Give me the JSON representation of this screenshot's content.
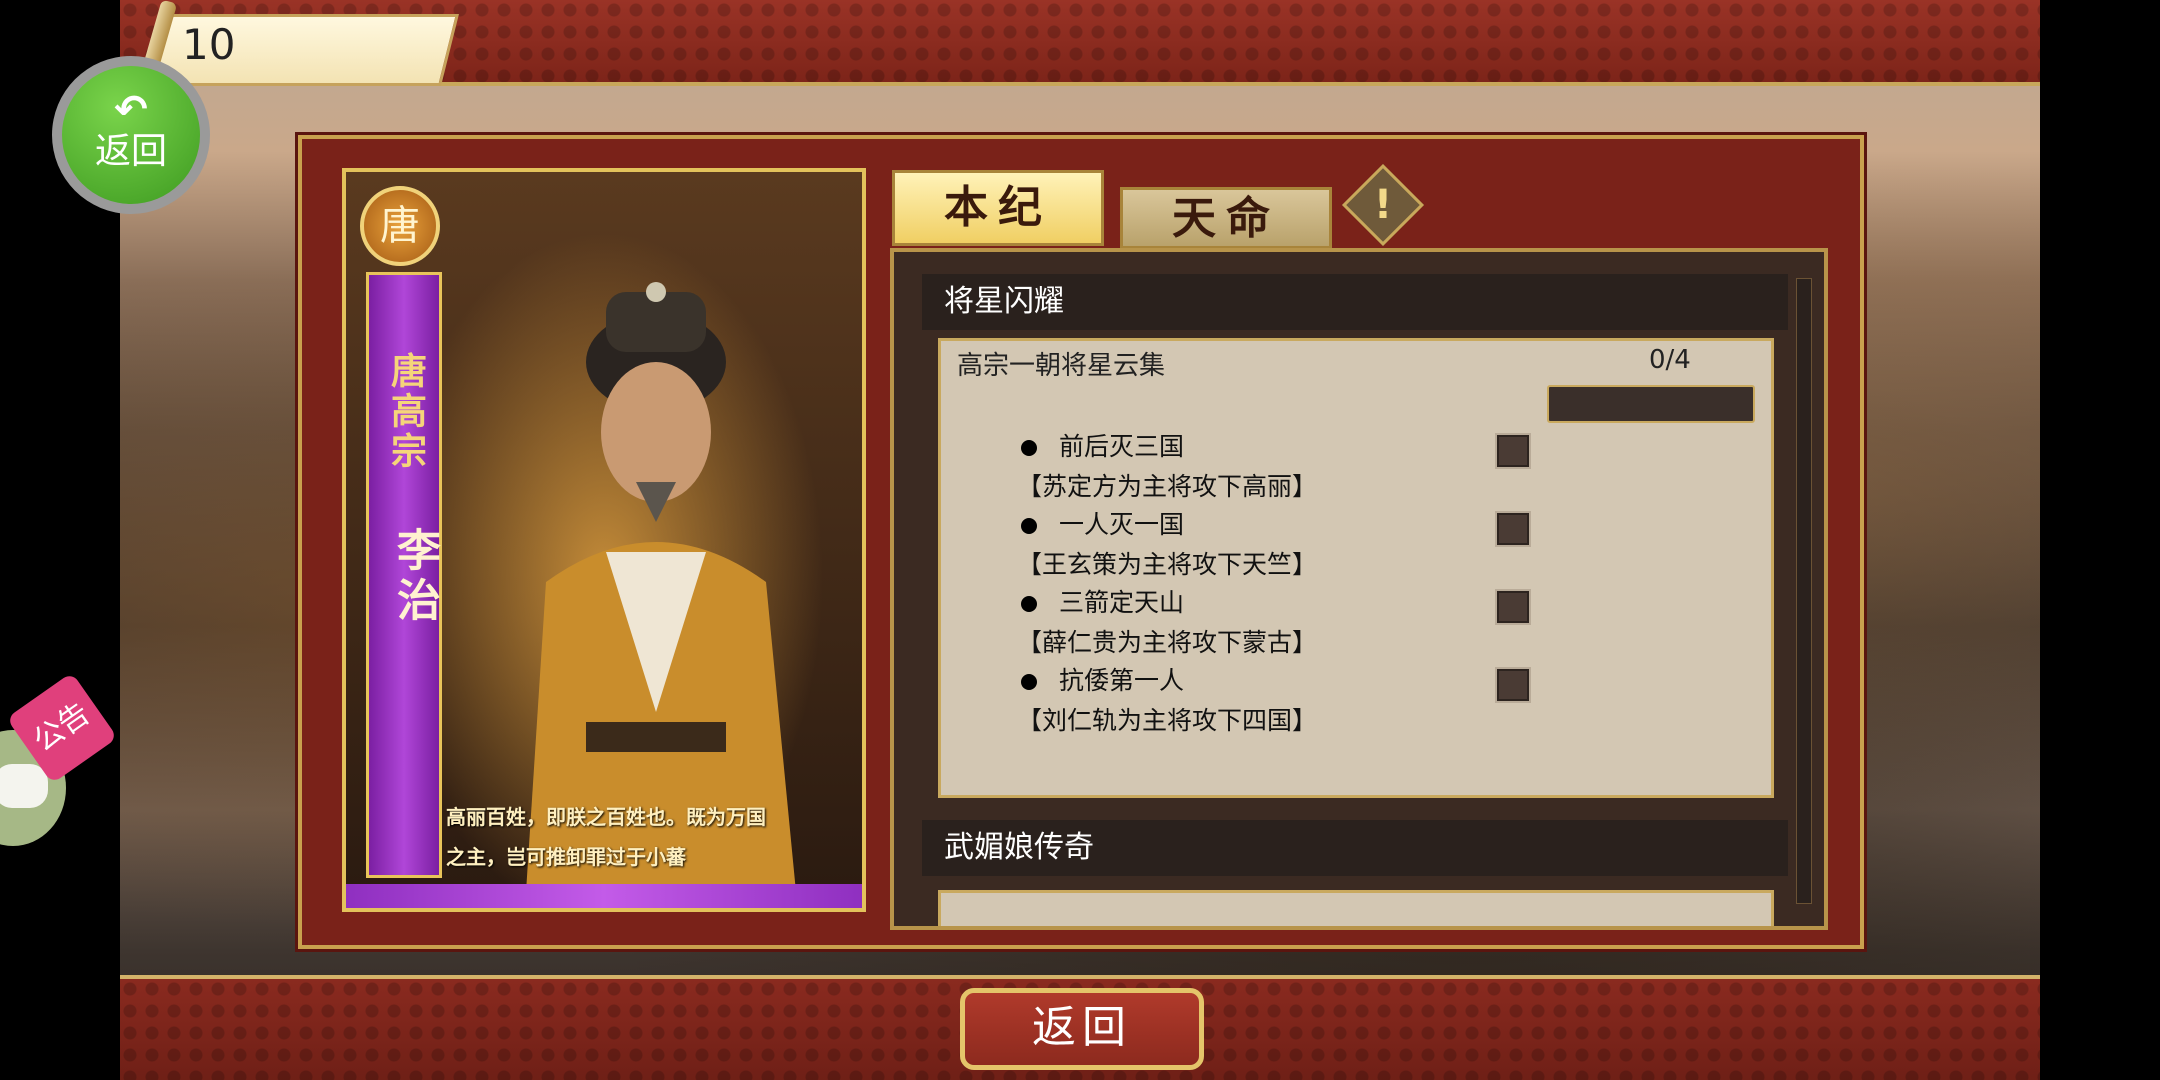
{
  "top": {
    "coins": "10"
  },
  "side": {
    "back_label": "返回",
    "notice_label": "公告"
  },
  "card": {
    "dynasty": "唐",
    "title": "唐高宗",
    "name": "李治",
    "quote_line1": "高丽百姓，即朕之百姓也。既为万国",
    "quote_line2": "之主，岂可推卸罪过于小蕃"
  },
  "tabs": [
    {
      "label": "本纪",
      "active": true
    },
    {
      "label": "天命",
      "active": false
    }
  ],
  "sections": [
    {
      "header": "将星闪耀",
      "quest": {
        "title": "高宗一朝将星云集",
        "progress_text": "0/4",
        "progress": 0,
        "tasks": [
          {
            "name": "前后灭三国",
            "desc": "【苏定方为主将攻下高丽】",
            "done": false
          },
          {
            "name": "一人灭一国",
            "desc": "【王玄策为主将攻下天竺】",
            "done": false
          },
          {
            "name": "三箭定天山",
            "desc": "【薛仁贵为主将攻下蒙古】",
            "done": false
          },
          {
            "name": "抗倭第一人",
            "desc": "【刘仁轨为主将攻下四国】",
            "done": false
          }
        ]
      }
    },
    {
      "header": "武媚娘传奇"
    }
  ],
  "footer": {
    "back_label": "返回"
  },
  "colors": {
    "accent_gold": "#c9a14e",
    "panel_red": "#7a2219",
    "active_tab": "#f0cf63"
  }
}
